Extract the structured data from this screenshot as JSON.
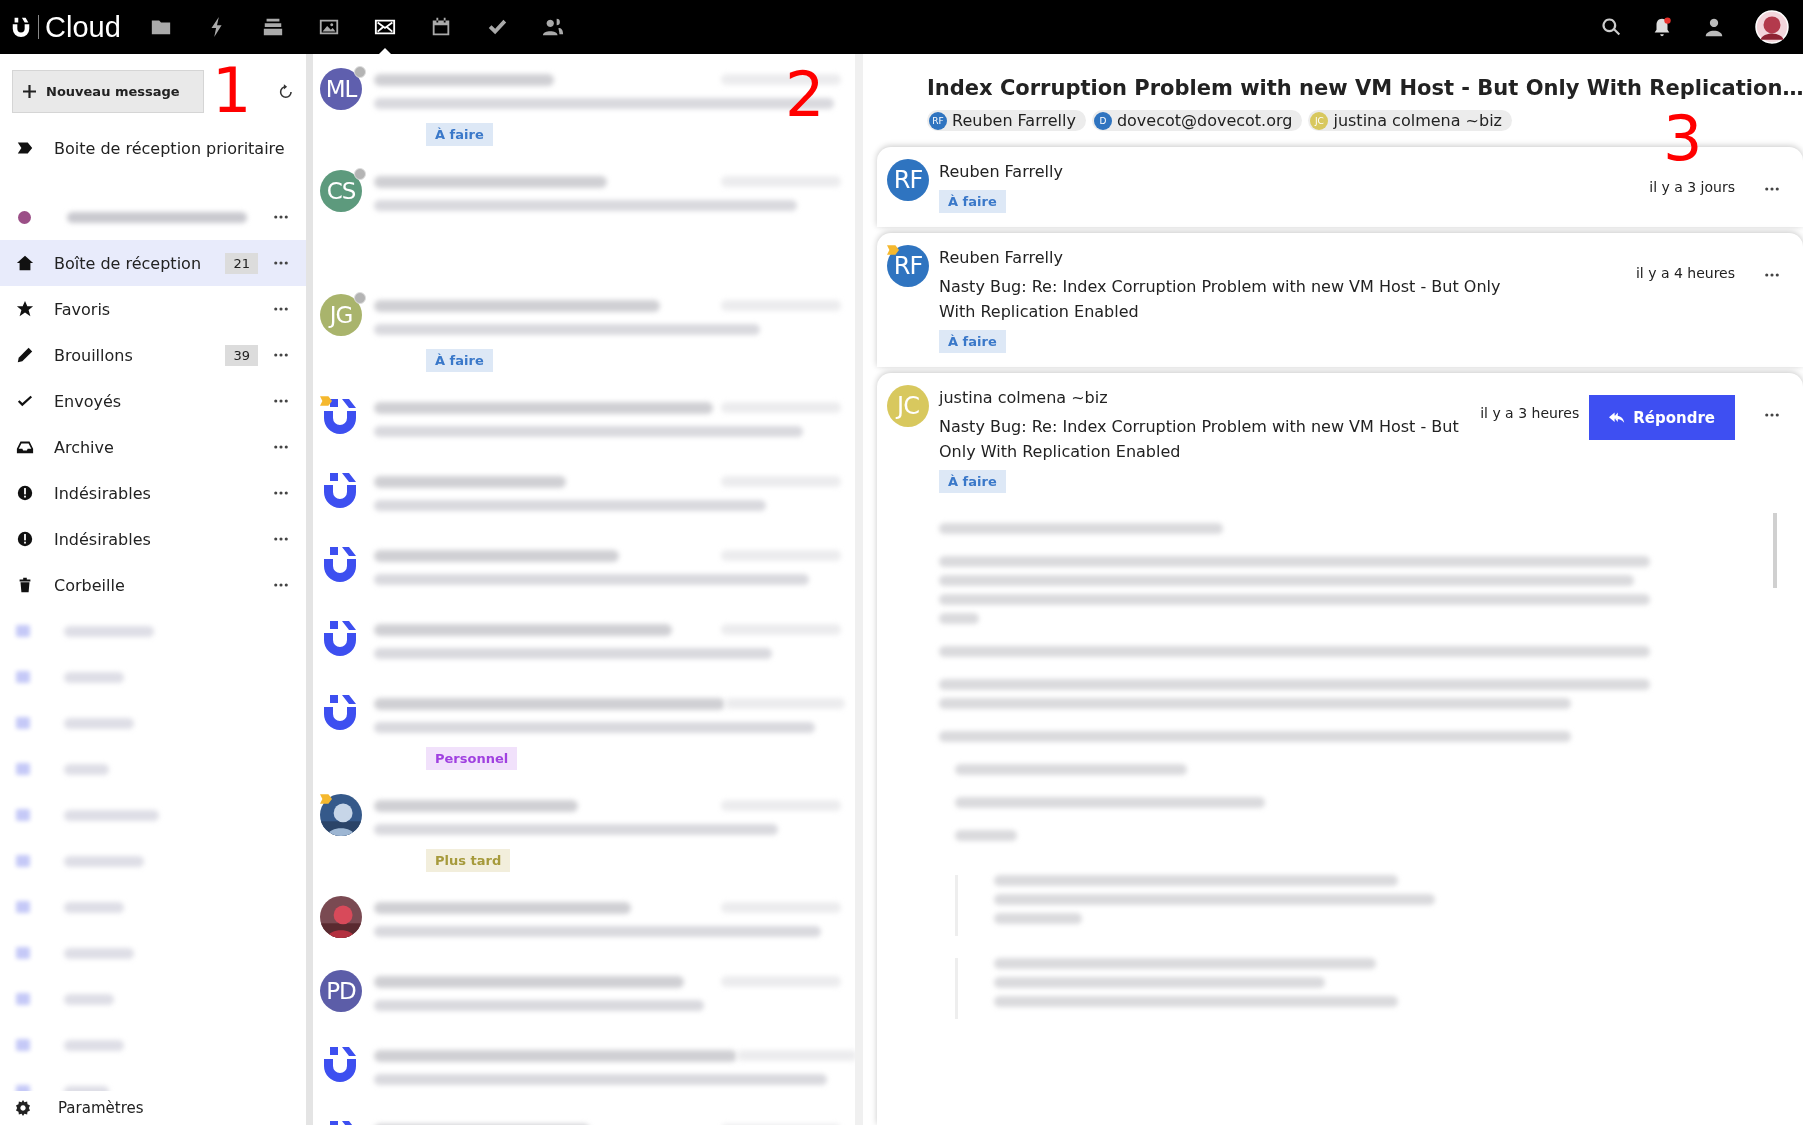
{
  "app": {
    "name": "Cloud"
  },
  "nav": [
    {
      "kind": "files",
      "selected": false
    },
    {
      "kind": "activity",
      "selected": false
    },
    {
      "kind": "deck",
      "selected": false
    },
    {
      "kind": "photos",
      "selected": false
    },
    {
      "kind": "mail",
      "selected": true
    },
    {
      "kind": "calendar",
      "selected": false
    },
    {
      "kind": "tasks",
      "selected": false
    },
    {
      "kind": "contacts",
      "selected": false
    }
  ],
  "sidebar": {
    "new_message": "Nouveau message",
    "priority": "Boite de réception prioritaire",
    "account": {
      "color": "#9b4f87"
    },
    "folders": [
      {
        "kind": "inbox",
        "label": "Boîte de réception",
        "count": "21",
        "selected": true
      },
      {
        "kind": "favorites",
        "label": "Favoris",
        "selected": false
      },
      {
        "kind": "drafts",
        "label": "Brouillons",
        "count": "39",
        "selected": false
      },
      {
        "kind": "sent",
        "label": "Envoyés",
        "selected": false
      },
      {
        "kind": "archive",
        "label": "Archive",
        "selected": false
      },
      {
        "kind": "junk",
        "label": "Indésirables",
        "selected": false
      },
      {
        "kind": "junk",
        "label": "Indésirables",
        "selected": false
      },
      {
        "kind": "trash",
        "label": "Corbeille",
        "selected": false
      }
    ],
    "settings": "Paramètres"
  },
  "messages": [
    {
      "avatar": {
        "kind": "initials",
        "text": "ML",
        "color": "#5f5fae"
      },
      "unread": true,
      "flagged": false,
      "tags": [
        {
          "label": "À faire",
          "kind": "todo"
        }
      ]
    },
    {
      "avatar": {
        "kind": "initials",
        "text": "CS",
        "color": "#5d9a7d"
      },
      "unread": true,
      "flagged": false,
      "tall": true
    },
    {
      "avatar": {
        "kind": "initials",
        "text": "JG",
        "color": "#a9b46c"
      },
      "unread": true,
      "flagged": false,
      "tags": [
        {
          "label": "À faire",
          "kind": "todo"
        }
      ]
    },
    {
      "avatar": {
        "kind": "logo"
      },
      "unread": false,
      "flagged": true
    },
    {
      "avatar": {
        "kind": "logo"
      },
      "unread": false,
      "flagged": false
    },
    {
      "avatar": {
        "kind": "logo"
      },
      "unread": false,
      "flagged": false
    },
    {
      "avatar": {
        "kind": "logo"
      },
      "unread": false,
      "flagged": false
    },
    {
      "avatar": {
        "kind": "logo"
      },
      "unread": false,
      "flagged": false,
      "tags": [
        {
          "label": "Personnel",
          "kind": "personal"
        }
      ]
    },
    {
      "unread": false,
      "flagged": true,
      "tags": [
        {
          "label": "Plus tard",
          "kind": "later"
        }
      ]
    },
    {
      "unread": false,
      "flagged": false
    },
    {
      "avatar": {
        "kind": "initials",
        "text": "PD",
        "color": "#5c5da8"
      },
      "unread": false,
      "flagged": false
    },
    {
      "avatar": {
        "kind": "logo"
      },
      "unread": false,
      "flagged": false
    },
    {
      "avatar": {
        "kind": "logo"
      },
      "unread": false,
      "flagged": false
    }
  ],
  "thread": {
    "title": "Index Corruption Problem with new VM Host - But Only With Replication…",
    "participants": [
      {
        "initials": "RF",
        "name": "Reuben Farrelly",
        "color": "#2f74c0"
      },
      {
        "initials": "D",
        "name": "dovecot@dovecot.org",
        "color": "#2f74c0"
      },
      {
        "initials": "JC",
        "name": "justina colmena ~biz",
        "color": "#d8c85e"
      }
    ],
    "messages": [
      {
        "initials": "RF",
        "color": "#2f74c0",
        "sender": "Reuben Farrelly",
        "time": "il y a 3 jours",
        "flagged": false,
        "expanded": false,
        "tags": [
          {
            "label": "À faire",
            "kind": "todo"
          }
        ]
      },
      {
        "initials": "RF",
        "color": "#2f74c0",
        "sender": "Reuben Farrelly",
        "subject": "Nasty Bug: Re: Index Corruption Problem with new VM Host - But Only With Replication Enabled",
        "time": "il y a 4 heures",
        "flagged": true,
        "expanded": false,
        "tags": [
          {
            "label": "À faire",
            "kind": "todo"
          }
        ]
      },
      {
        "initials": "JC",
        "color": "#d8c85e",
        "sender": "justina colmena ~biz",
        "subject": "Nasty Bug: Re: Index Corruption Problem with new VM Host - But Only With Replication Enabled",
        "time": "il y a 3 heures",
        "flagged": false,
        "expanded": true,
        "reply": "Répondre",
        "tags": [
          {
            "label": "À faire",
            "kind": "todo"
          }
        ]
      }
    ]
  },
  "annotations": [
    "1",
    "2",
    "3"
  ]
}
